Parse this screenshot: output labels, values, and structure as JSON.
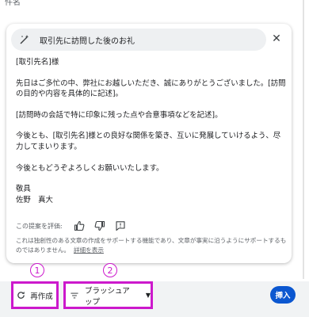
{
  "subject_label": "件名",
  "help_me_write": {
    "prompt": "取引先に訪問した後のお礼",
    "draft": {
      "salutation": "[取引先名]様",
      "para1": "先日はご多忙の中、弊社にお越しいただき、誠にありがとうございました。[訪問の目的や内容を具体的に記述]。",
      "para2": "[訪問時の会話で特に印象に残った点や合意事項などを記述]。",
      "para3": "今後とも、[取引先名]様との良好な関係を築き、互いに発展していけるよう、尽力してまいります。",
      "para4": "今後ともどうぞよろしくお願いいたします。",
      "closing": "敬具",
      "signature": "佐野　真大"
    },
    "feedback_label": "この提案を評価:",
    "disclaimer": "これは独創性のある文章の作成をサポートする機能であり、文章が事実に沿うようにサポートするものではありません。",
    "details_link": "詳細を表示"
  },
  "toolbar": {
    "regenerate_label": "再作成",
    "refine_label": "ブラッシュアップ",
    "insert_label": "挿入"
  },
  "annotations": {
    "marker1": "1",
    "marker2": "2"
  },
  "colors": {
    "annotation": "#cc19cc",
    "insert_button": "#0b57d0"
  },
  "icons": {
    "prompt": "magic-wand-icon",
    "close": "close-icon",
    "thumbs_up": "thumbs-up-icon",
    "thumbs_down": "thumbs-down-icon",
    "feedback": "feedback-icon",
    "regenerate": "refresh-icon",
    "refine": "filter-lines-icon",
    "dropdown": "caret-down-icon"
  }
}
